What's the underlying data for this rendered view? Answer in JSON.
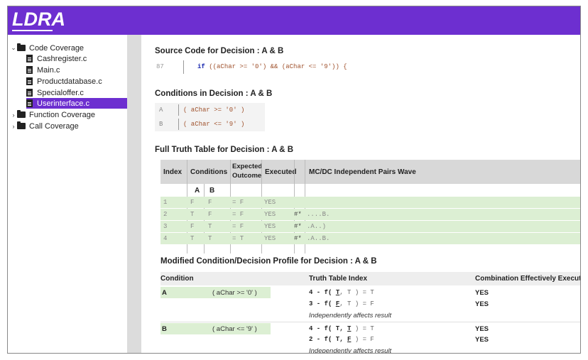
{
  "app": {
    "logo": "LDRA",
    "accent": "#6d2fd0"
  },
  "tree": {
    "root": {
      "label": "Code Coverage",
      "toggle": "⌄"
    },
    "files": [
      "Cashregister.c",
      "Main.c",
      "Productdatabase.c",
      "Specialoffer.c",
      "Userinterface.c"
    ],
    "selected_file": "Userinterface.c",
    "others": [
      {
        "label": "Function Coverage",
        "toggle": "›"
      },
      {
        "label": "Call Coverage",
        "toggle": "›"
      }
    ]
  },
  "source": {
    "title": "Source Code for Decision : A & B",
    "line_no": "87",
    "keyword": "if",
    "code": "((aChar >= '0') && (aChar <= '9')) {"
  },
  "conditions": {
    "title": "Conditions in Decision : A & B",
    "rows": [
      {
        "label": "A",
        "expr": "( aChar >= '0' )"
      },
      {
        "label": "B",
        "expr": "( aChar <= '9' )"
      }
    ]
  },
  "truth_table": {
    "title": "Full Truth Table for Decision : A & B",
    "headers": {
      "index": "Index",
      "conditions": "Conditions",
      "expected_1": "Expected",
      "expected_2": "Outcome",
      "executed": "Executed",
      "pairs": "MC/DC Independent Pairs Wave",
      "a": "A",
      "b": "B"
    },
    "rows": [
      {
        "index": "1",
        "a": "F",
        "b": "F",
        "outcome": "= F",
        "executed": "YES",
        "mark": "",
        "pairs": ""
      },
      {
        "index": "2",
        "a": "T",
        "b": "F",
        "outcome": "= F",
        "executed": "YES",
        "mark": "#*",
        "pairs": "....B."
      },
      {
        "index": "3",
        "a": "F",
        "b": "T",
        "outcome": "= F",
        "executed": "YES",
        "mark": "#*",
        "pairs": ".A..)"
      },
      {
        "index": "4",
        "a": "T",
        "b": "T",
        "outcome": "= T",
        "executed": "YES",
        "mark": "#*",
        "pairs": ".A..B."
      }
    ]
  },
  "mcdc": {
    "title": "Modified Condition/Decision Profile for Decision : A & B",
    "headers": {
      "condition": "Condition",
      "tti": "Truth Table Index",
      "comb": "Combination Effectively Executed"
    },
    "groups": [
      {
        "name": "A",
        "expr": "( aChar >= '0' )",
        "lines": [
          {
            "pre": "4 - f( ",
            "u": "T",
            "post": ", T )  =  T",
            "exec": "YES"
          },
          {
            "pre": "3 - f( ",
            "u": "F",
            "post": ", T )  =  F",
            "exec": "YES"
          }
        ],
        "note": "Independently affects result"
      },
      {
        "name": "B",
        "expr": "( aChar <= '9' )",
        "lines": [
          {
            "pre": "4 - f( T, ",
            "u": "T",
            "post": " )  =  T",
            "exec": "YES"
          },
          {
            "pre": "2 - f( T, ",
            "u": "F",
            "post": " )  =  F",
            "exec": "YES"
          }
        ],
        "note": "Independently affects result"
      }
    ]
  }
}
